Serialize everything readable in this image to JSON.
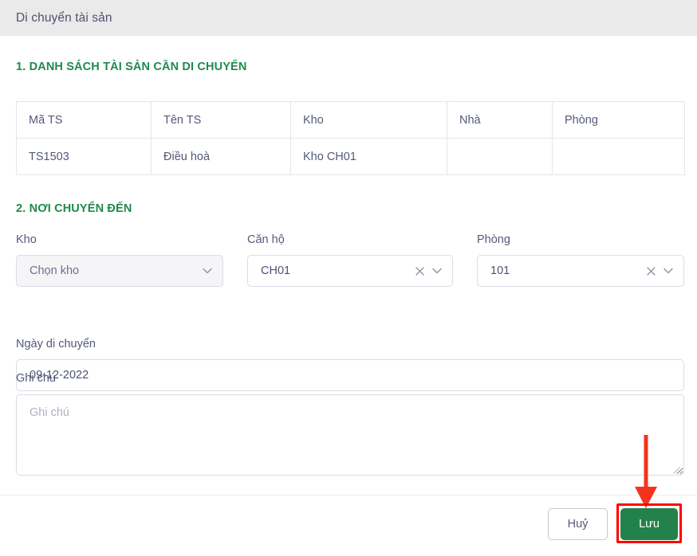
{
  "header": {
    "title": "Di chuyển tài sản"
  },
  "sections": {
    "assets": {
      "title": "1. DANH SÁCH TÀI SẢN CẦN DI CHUYỂN",
      "columns": [
        "Mã TS",
        "Tên TS",
        "Kho",
        "Nhà",
        "Phòng"
      ],
      "rows": [
        {
          "ma_ts": "TS1503",
          "ten_ts": "Điều hoà",
          "kho": "Kho CH01",
          "nha": "",
          "phong": ""
        }
      ]
    },
    "destination": {
      "title": "2. NƠI CHUYỂN ĐẾN",
      "fields": {
        "kho": {
          "label": "Kho",
          "value": "Chọn kho",
          "is_placeholder": true,
          "disabled": true,
          "clearable": false
        },
        "can_ho": {
          "label": "Căn hộ",
          "value": "CH01",
          "is_placeholder": false,
          "disabled": false,
          "clearable": true
        },
        "phong": {
          "label": "Phòng",
          "value": "101",
          "is_placeholder": false,
          "disabled": false,
          "clearable": true
        },
        "ngay_di_chuyen": {
          "label": "Ngày di chuyển",
          "value": "09-12-2022"
        },
        "ghi_chu": {
          "label": "Ghi chú",
          "value": "",
          "placeholder": "Ghi chú"
        }
      }
    }
  },
  "footer": {
    "cancel_label": "Huỷ",
    "save_label": "Lưu"
  },
  "annotation": {
    "arrow_color": "#f4331c",
    "highlight_color": "#ff0000",
    "target": "save-button"
  },
  "colors": {
    "header_bg": "#eaeaea",
    "section_green": "#1f8a4d",
    "save_green": "#23824b",
    "text": "#54597a",
    "border": "#dcdce4"
  }
}
